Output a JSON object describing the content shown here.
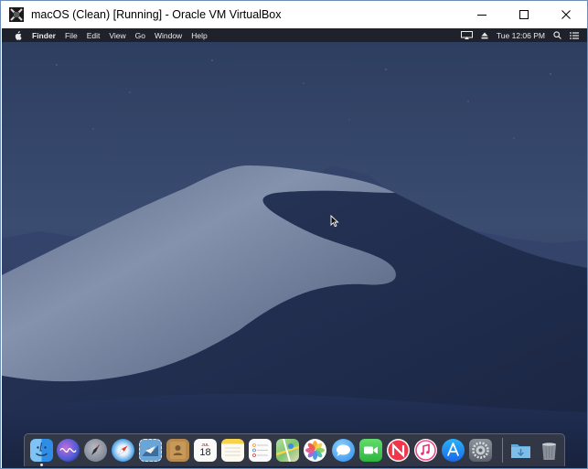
{
  "window": {
    "title": "macOS (Clean) [Running] - Oracle VM VirtualBox"
  },
  "menubar": {
    "items": [
      "Finder",
      "File",
      "Edit",
      "View",
      "Go",
      "Window",
      "Help"
    ],
    "clock": "Tue 12:06 PM"
  },
  "dock": {
    "apps": [
      {
        "name": "Finder",
        "icon": "finder-icon",
        "running": true
      },
      {
        "name": "Siri",
        "icon": "siri-icon"
      },
      {
        "name": "Launchpad",
        "icon": "launchpad-icon"
      },
      {
        "name": "Safari",
        "icon": "safari-icon"
      },
      {
        "name": "Mail",
        "icon": "mail-icon"
      },
      {
        "name": "Contacts",
        "icon": "contacts-icon"
      },
      {
        "name": "Calendar",
        "icon": "calendar-icon",
        "month": "JUL",
        "day": "18"
      },
      {
        "name": "Notes",
        "icon": "notes-icon"
      },
      {
        "name": "Reminders",
        "icon": "reminders-icon"
      },
      {
        "name": "Maps",
        "icon": "maps-icon"
      },
      {
        "name": "Photos",
        "icon": "photos-icon"
      },
      {
        "name": "Messages",
        "icon": "messages-icon"
      },
      {
        "name": "FaceTime",
        "icon": "facetime-icon"
      },
      {
        "name": "News",
        "icon": "news-icon"
      },
      {
        "name": "iTunes",
        "icon": "itunes-icon"
      },
      {
        "name": "App Store",
        "icon": "app-store-icon"
      },
      {
        "name": "System Preferences",
        "icon": "system-preferences-icon"
      },
      {
        "name": "Downloads",
        "icon": "downloads-folder-icon"
      },
      {
        "name": "Trash",
        "icon": "trash-icon"
      }
    ]
  },
  "colors": {
    "sky_top": "#2a3a5c",
    "dune_light": "#7d8aa6",
    "dune_dark": "#1f2c48",
    "menubar_bg": "#1e2026"
  }
}
